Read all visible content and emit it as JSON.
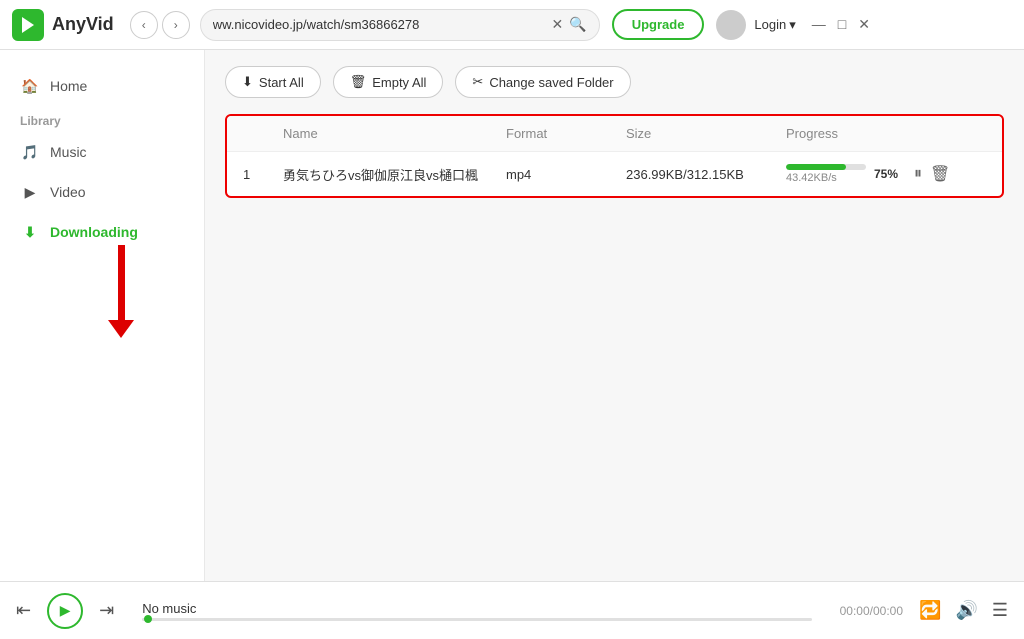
{
  "titlebar": {
    "app_name": "AnyVid",
    "url": "ww.nicovideo.jp/watch/sm36866278",
    "upgrade_label": "Upgrade",
    "login_label": "Login"
  },
  "toolbar": {
    "start_all_label": "Start All",
    "empty_all_label": "Empty All",
    "change_folder_label": "Change saved Folder"
  },
  "table": {
    "headers": [
      "",
      "Name",
      "Format",
      "Size",
      "Progress"
    ],
    "rows": [
      {
        "index": "1",
        "name": "勇気ちひろvs御伽原江良vs樋口楓",
        "format": "mp4",
        "size": "236.99KB/312.15KB",
        "progress_pct": "75%",
        "speed": "43.42KB/s",
        "fill_width": "75"
      }
    ]
  },
  "sidebar": {
    "home_label": "Home",
    "library_label": "Library",
    "music_label": "Music",
    "video_label": "Video",
    "downloading_label": "Downloading"
  },
  "player": {
    "no_music_label": "No music",
    "time": "00:00/00:00"
  }
}
